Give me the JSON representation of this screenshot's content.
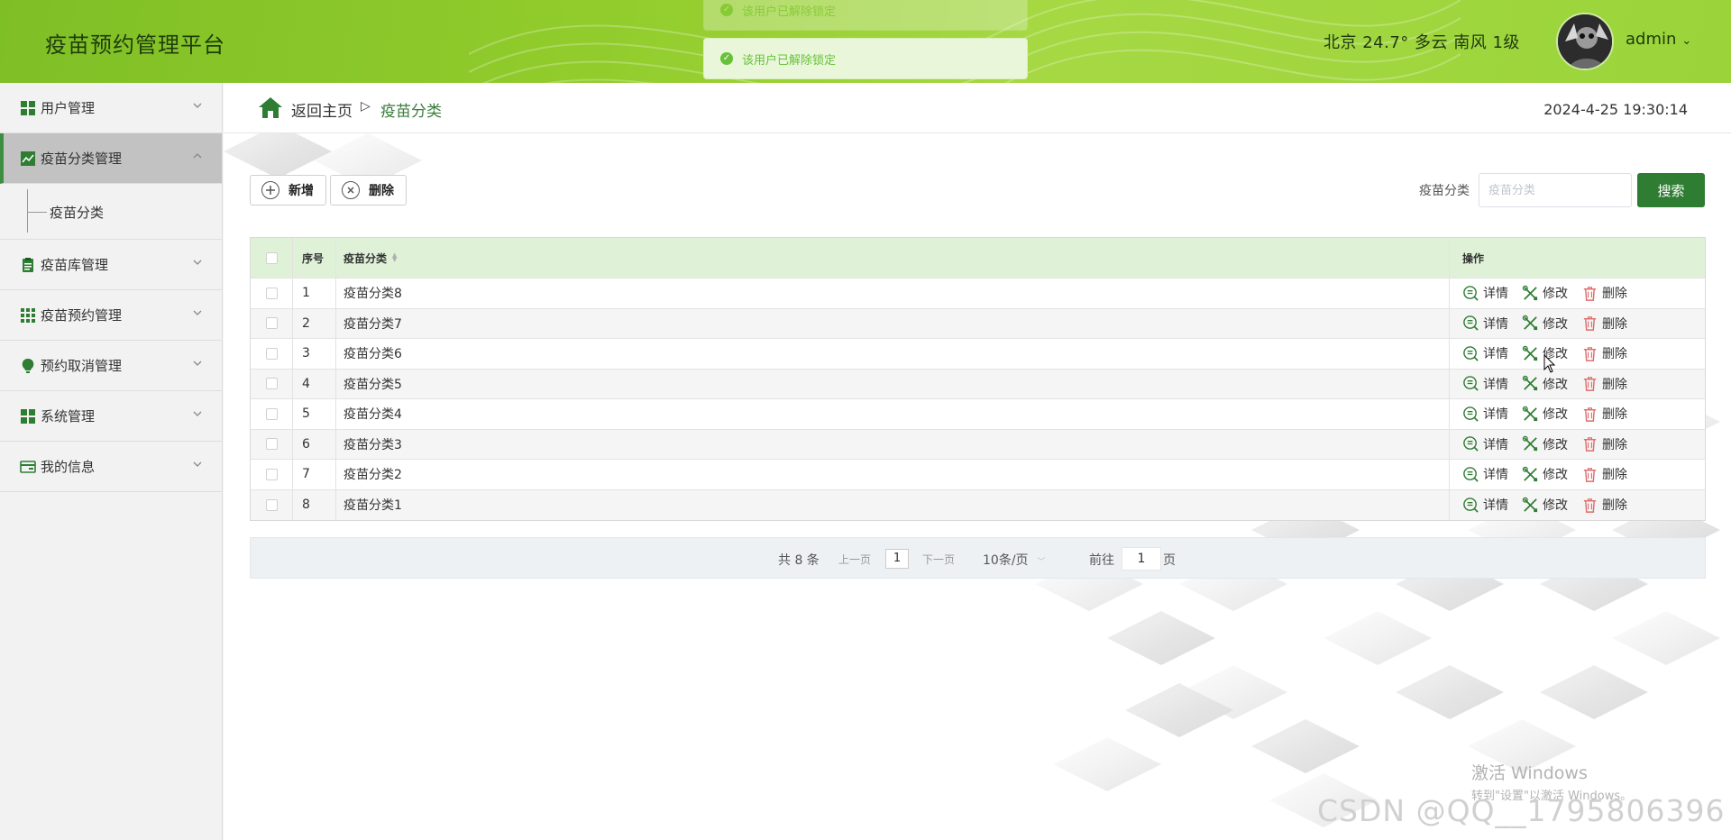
{
  "app": {
    "title": "疫苗预约管理平台"
  },
  "header": {
    "weather": "北京 24.7° 多云 南风 1级",
    "username": "admin",
    "chevron": "⌄"
  },
  "toasts": [
    {
      "text": "该用户已解除锁定",
      "faded": true
    },
    {
      "text": "该用户已解除锁定",
      "faded": false
    }
  ],
  "sidebar": {
    "items": [
      {
        "label": "用户管理",
        "icon": "grid-icon"
      },
      {
        "label": "疫苗分类管理",
        "icon": "chart-icon",
        "active": true,
        "children": [
          {
            "label": "疫苗分类"
          }
        ]
      },
      {
        "label": "疫苗库管理",
        "icon": "clipboard-icon"
      },
      {
        "label": "疫苗预约管理",
        "icon": "apps-icon"
      },
      {
        "label": "预约取消管理",
        "icon": "bulb-icon"
      },
      {
        "label": "系统管理",
        "icon": "grid-icon"
      },
      {
        "label": "我的信息",
        "icon": "card-icon"
      }
    ]
  },
  "breadcrumb": {
    "back": "返回主页",
    "separator": "▷",
    "current": "疫苗分类"
  },
  "datetime": "2024-4-25 19:30:14",
  "toolbar": {
    "add_label": "新增",
    "delete_label": "删除"
  },
  "search": {
    "label": "疫苗分类",
    "placeholder": "疫苗分类",
    "button": "搜索"
  },
  "table": {
    "headers": {
      "index": "序号",
      "name": "疫苗分类",
      "ops": "操作"
    },
    "rows": [
      {
        "index": "1",
        "name": "疫苗分类8"
      },
      {
        "index": "2",
        "name": "疫苗分类7"
      },
      {
        "index": "3",
        "name": "疫苗分类6"
      },
      {
        "index": "4",
        "name": "疫苗分类5"
      },
      {
        "index": "5",
        "name": "疫苗分类4"
      },
      {
        "index": "6",
        "name": "疫苗分类3"
      },
      {
        "index": "7",
        "name": "疫苗分类2"
      },
      {
        "index": "8",
        "name": "疫苗分类1"
      }
    ],
    "actions": {
      "detail": "详情",
      "edit": "修改",
      "delete": "删除"
    }
  },
  "pagination": {
    "total": "共 8 条",
    "prev": "上一页",
    "current_page": "1",
    "next": "下一页",
    "page_size": "10条/页",
    "goto_prefix": "前往",
    "goto_value": "1",
    "goto_suffix": "页"
  },
  "watermarks": {
    "windows_line1": "激活 Windows",
    "windows_line2": "转到\"设置\"以激活 Windows。",
    "csdn": "CSDN @QQ__1795806396"
  },
  "colors": {
    "header_green": "#8fca2e",
    "primary_green": "#2f7d32",
    "table_header": "#dff2d8",
    "toast_bg": "#eaf6da",
    "toast_text": "#67c23a",
    "delete_red": "#e06c6c"
  }
}
